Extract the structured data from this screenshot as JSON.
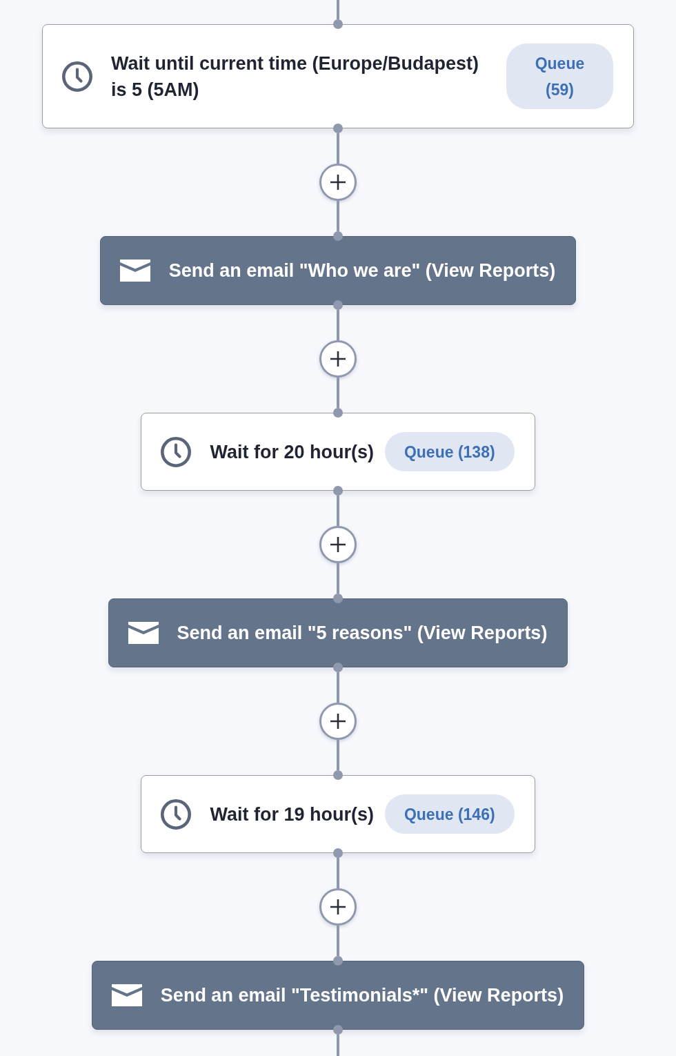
{
  "flow": {
    "steps": [
      {
        "kind": "wait",
        "text": "Wait until current time (Europe/Budapest) is 5 (5AM)",
        "queue": "Queue (59)"
      },
      {
        "kind": "email",
        "text": "Send an email \"Who we are\" (View Reports)"
      },
      {
        "kind": "wait",
        "text": "Wait for 20 hour(s)",
        "queue": "Queue (138)"
      },
      {
        "kind": "email",
        "text": "Send an email \"5 reasons\" (View Reports)"
      },
      {
        "kind": "wait",
        "text": "Wait for 19 hour(s)",
        "queue": "Queue (146)"
      },
      {
        "kind": "email",
        "text": "Send an email \"Testimonials*\" (View Reports)"
      }
    ]
  }
}
